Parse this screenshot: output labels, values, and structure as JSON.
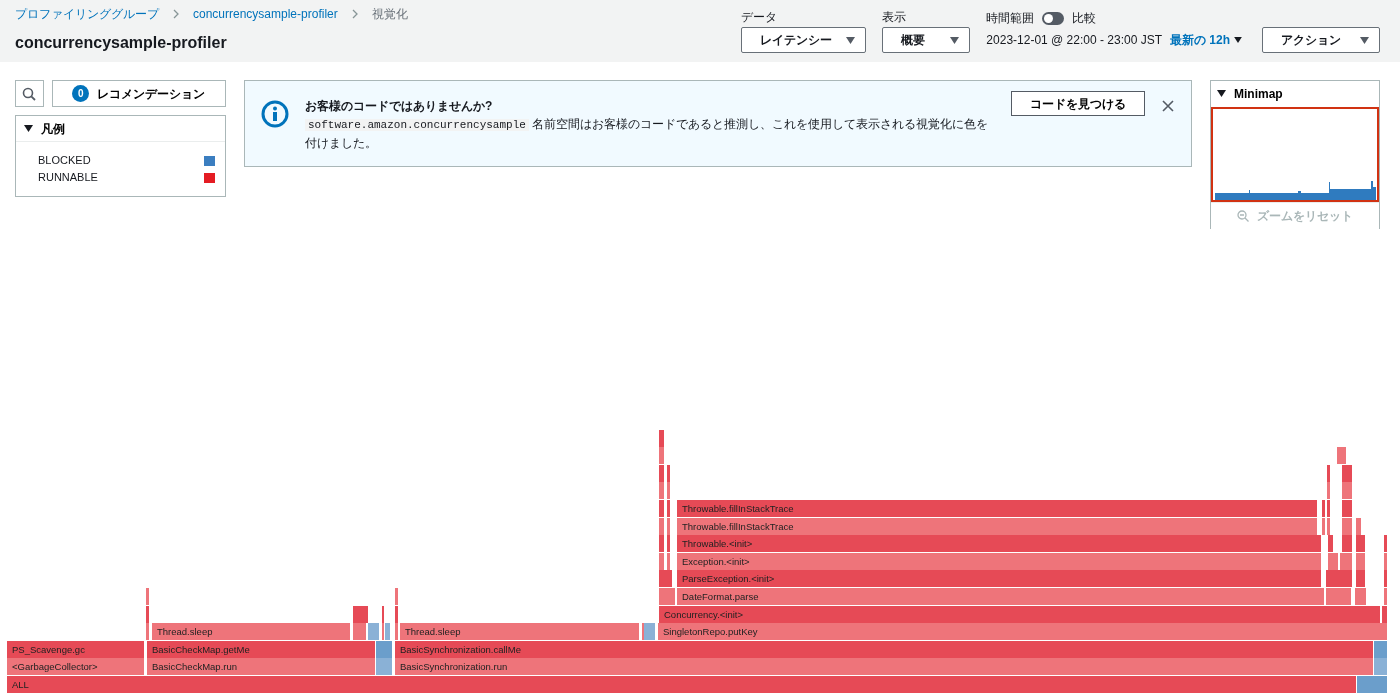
{
  "breadcrumbs": [
    {
      "label": "プロファイリンググループ",
      "link": true
    },
    {
      "label": "concurrencysample-profiler",
      "link": true
    },
    {
      "label": "視覚化",
      "link": false
    }
  ],
  "title": "concurrencysample-profiler",
  "controls": {
    "data": {
      "label": "データ",
      "value": "レイテンシー"
    },
    "view": {
      "label": "表示",
      "value": "概要"
    },
    "time_range": {
      "label": "時間範囲",
      "compare": {
        "label": "比較",
        "on": false
      },
      "range": "2023-12-01 @ 22:00 - 23:00 JST",
      "preset": "最新の 12h"
    },
    "actions": "アクション"
  },
  "recommendations": {
    "count": "0",
    "label": "レコメンデーション"
  },
  "legend": {
    "title": "凡例",
    "expanded": true,
    "items": [
      {
        "label": "BLOCKED",
        "color": "#3b7ec0"
      },
      {
        "label": "RUNNABLE",
        "color": "#e41c23"
      }
    ]
  },
  "alert": {
    "title": "お客様のコードではありませんか?",
    "namespace": "software.amazon.concurrencysample",
    "message": "名前空間はお客様のコードであると推測し、これを使用して表示される視覚化に色を付けました。",
    "button": "コードを見つける"
  },
  "minimap": {
    "title": "Minimap",
    "expanded": true,
    "reset": {
      "label": "ズームをリセット",
      "disabled": true
    }
  },
  "flame_graph": {
    "rows": [
      {
        "frames": [
          {
            "blocked": false
          }
        ]
      },
      {
        "frames": [
          {
            "blocked": false
          },
          {
            "blocked": false
          }
        ]
      },
      {
        "frames": [
          {
            "blocked": false
          },
          {
            "blocked": false
          },
          {
            "blocked": false
          },
          {
            "blocked": false
          }
        ]
      },
      {
        "frames": [
          {
            "blocked": false
          },
          {
            "blocked": false
          },
          {
            "blocked": false
          },
          {
            "blocked": false
          }
        ]
      },
      {
        "frames": [
          {
            "blocked": false
          },
          {
            "blocked": false
          },
          {
            "label": "Throwable.fillInStackTrace",
            "blocked": false
          },
          {
            "blocked": false
          },
          {
            "blocked": false
          },
          {
            "blocked": false
          }
        ]
      },
      {
        "frames": [
          {
            "blocked": false
          },
          {
            "blocked": false
          },
          {
            "label": "Throwable.fillInStackTrace",
            "blocked": false
          },
          {
            "blocked": false
          },
          {
            "blocked": false
          },
          {
            "blocked": false
          },
          {
            "blocked": false
          }
        ]
      },
      {
        "frames": [
          {
            "blocked": false
          },
          {
            "blocked": false
          },
          {
            "label": "Throwable.<init>",
            "blocked": false
          },
          {
            "blocked": false
          },
          {
            "blocked": false
          },
          {
            "blocked": false
          },
          {
            "blocked": false
          }
        ]
      },
      {
        "frames": [
          {
            "blocked": false
          },
          {
            "blocked": false
          },
          {
            "label": "Exception.<init>",
            "blocked": false
          },
          {
            "blocked": false
          },
          {
            "blocked": false
          },
          {
            "blocked": false
          },
          {
            "blocked": false
          }
        ]
      },
      {
        "frames": [
          {
            "blocked": false
          },
          {
            "label": "ParseException.<init>",
            "blocked": false
          },
          {
            "blocked": false
          },
          {
            "blocked": false
          },
          {
            "blocked": false
          }
        ]
      },
      {
        "frames": [
          {
            "blocked": false
          },
          {
            "blocked": false
          },
          {
            "blocked": false
          },
          {
            "label": "DateFormat.parse",
            "blocked": false
          },
          {
            "blocked": false
          },
          {
            "blocked": false
          },
          {
            "blocked": false
          }
        ]
      },
      {
        "frames": [
          {
            "blocked": false
          },
          {
            "blocked": false
          },
          {
            "blocked": false
          },
          {
            "blocked": false
          },
          {
            "label": "Concurrency.<init>",
            "blocked": false
          },
          {
            "blocked": false
          }
        ]
      },
      {
        "frames": [
          {
            "blocked": false
          },
          {
            "label": "Thread.sleep",
            "blocked": false
          },
          {
            "blocked": false
          },
          {
            "blocked": true
          },
          {
            "blocked": false
          },
          {
            "blocked": true
          },
          {
            "blocked": false
          },
          {
            "label": "Thread.sleep",
            "blocked": false
          },
          {
            "blocked": false
          },
          {
            "blocked": true
          },
          {
            "label": "SingletonRepo.putKey",
            "blocked": false
          }
        ]
      },
      {
        "frames": [
          {
            "label": "PS_Scavenge.gc",
            "blocked": false
          },
          {
            "label": "BasicCheckMap.getMe",
            "blocked": false
          },
          {
            "blocked": true
          },
          {
            "label": "BasicSynchronization.callMe",
            "blocked": false
          },
          {
            "blocked": true
          }
        ]
      },
      {
        "frames": [
          {
            "label": "<GarbageCollector>",
            "blocked": false
          },
          {
            "label": "BasicCheckMap.run",
            "blocked": false
          },
          {
            "blocked": true
          },
          {
            "label": "BasicSynchronization.run",
            "blocked": false
          },
          {
            "blocked": true
          }
        ]
      },
      {
        "frames": [
          {
            "label": "ALL",
            "blocked": false
          },
          {
            "blocked": true
          }
        ]
      }
    ]
  }
}
